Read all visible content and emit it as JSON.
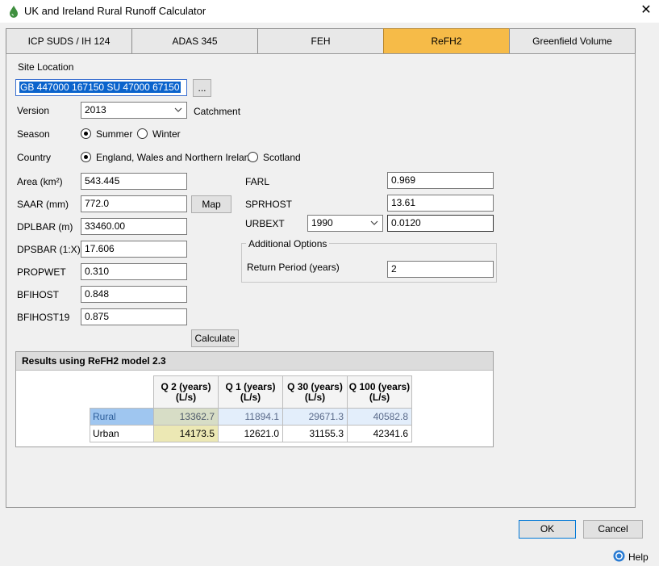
{
  "window": {
    "title": "UK and Ireland Rural Runoff Calculator"
  },
  "tabs": [
    {
      "label": "ICP SUDS / IH 124"
    },
    {
      "label": "ADAS 345"
    },
    {
      "label": "FEH"
    },
    {
      "label": "ReFH2"
    },
    {
      "label": "Greenfield Volume"
    }
  ],
  "active_tab": "ReFH2",
  "site": {
    "label": "Site Location",
    "value": "GB 447000 167150 SU 47000 67150",
    "browse_label": "..."
  },
  "version": {
    "label": "Version",
    "value": "2013",
    "catchment_label": "Catchment"
  },
  "season": {
    "label": "Season",
    "options": [
      "Summer",
      "Winter"
    ],
    "selected": "Summer"
  },
  "country": {
    "label": "Country",
    "options": [
      "England, Wales and Northern Ireland",
      "Scotland"
    ],
    "selected": "England, Wales and Northern Ireland"
  },
  "params_left": [
    {
      "label": "Area (km²)",
      "value": "543.445"
    },
    {
      "label": "SAAR (mm)",
      "value": "772.0"
    },
    {
      "label": "DPLBAR (m)",
      "value": "33460.00"
    },
    {
      "label": "DPSBAR (1:X)",
      "value": "17.606"
    },
    {
      "label": "PROPWET",
      "value": "0.310"
    },
    {
      "label": "BFIHOST",
      "value": "0.848"
    },
    {
      "label": "BFIHOST19",
      "value": "0.875"
    }
  ],
  "map_label": "Map",
  "params_right": {
    "farl": {
      "label": "FARL",
      "value": "0.969"
    },
    "sprhost": {
      "label": "SPRHOST",
      "value": "13.61"
    },
    "urbext": {
      "label": "URBEXT",
      "year": "1990",
      "value": "0.0120"
    }
  },
  "additional_options": {
    "title": "Additional Options",
    "return_period_label": "Return Period (years)",
    "return_period_value": "2"
  },
  "calculate_label": "Calculate",
  "results": {
    "title": "Results using ReFH2 model 2.3",
    "columns": [
      "Q 2 (years)\n(L/s)",
      "Q 1 (years)\n(L/s)",
      "Q 30 (years)\n(L/s)",
      "Q 100 (years)\n(L/s)"
    ],
    "rows": [
      {
        "name": "Rural",
        "values": [
          "13362.7",
          "11894.1",
          "29671.3",
          "40582.8"
        ]
      },
      {
        "name": "Urban",
        "values": [
          "14173.5",
          "12621.0",
          "31155.3",
          "42341.6"
        ]
      }
    ]
  },
  "footer": {
    "ok_label": "OK",
    "cancel_label": "Cancel",
    "help_label": "Help"
  },
  "colors": {
    "active_tab": "#f6bb48",
    "selection": "#0a63cc"
  }
}
